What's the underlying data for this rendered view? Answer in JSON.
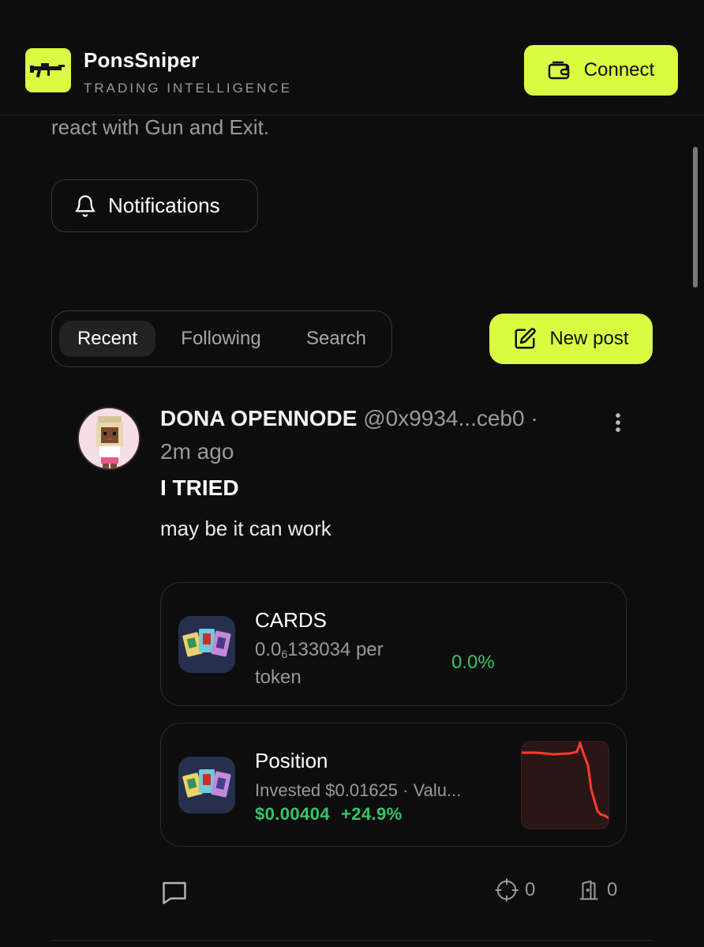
{
  "header": {
    "brand": "PonsSniper",
    "tagline": "TRADING INTELLIGENCE",
    "connect_label": "Connect",
    "logo_icon": "rifle-icon",
    "accent_color": "#d9fb42"
  },
  "intro": {
    "text": "react with Gun and Exit.",
    "notifications_label": "Notifications"
  },
  "tabs": [
    {
      "label": "Recent",
      "active": true
    },
    {
      "label": "Following",
      "active": false
    },
    {
      "label": "Search",
      "active": false
    }
  ],
  "new_post_label": "New post",
  "post": {
    "author_name": "DONA OPENNODE",
    "author_handle": "@0x9934...ceb0 ·",
    "time": "2m ago",
    "title": "I TRIED",
    "body": "may be it can work",
    "token": {
      "name": "CARDS",
      "price_prefix": "0.0",
      "price_zeros": "6",
      "price_digits": "133034",
      "price_suffix": "per token",
      "change": "0.0%"
    },
    "position": {
      "title": "Position",
      "invested": "Invested $0.01625 · Valu...",
      "value": "$0.00404",
      "change": "+24.9%",
      "sparkline_color": "#ff3b30"
    },
    "actions": {
      "comment_icon": "comment-icon",
      "gun_count": "0",
      "exit_count": "0"
    }
  }
}
